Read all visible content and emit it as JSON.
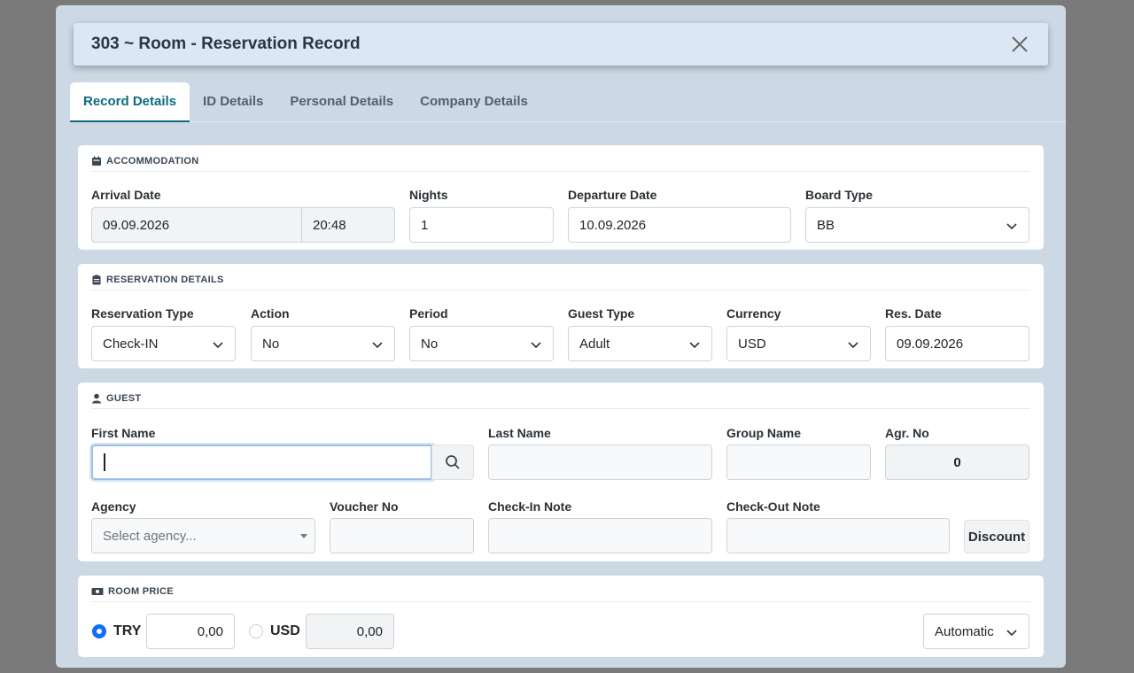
{
  "modal": {
    "title": "303 ~ Room - Reservation Record"
  },
  "tabs": [
    "Record Details",
    "ID Details",
    "Personal Details",
    "Company Details"
  ],
  "accommodation": {
    "title": "ACCOMMODATION",
    "arrival_label": "Arrival Date",
    "arrival_date": "09.09.2026",
    "arrival_time": "20:48",
    "nights_label": "Nights",
    "nights": "1",
    "departure_label": "Departure Date",
    "departure_date": "10.09.2026",
    "board_label": "Board Type",
    "board": "BB"
  },
  "reservation": {
    "title": "RESERVATION DETAILS",
    "type_label": "Reservation Type",
    "type": "Check-IN",
    "action_label": "Action",
    "action": "No",
    "period_label": "Period",
    "period": "No",
    "guest_type_label": "Guest Type",
    "guest_type": "Adult",
    "currency_label": "Currency",
    "currency": "USD",
    "res_date_label": "Res. Date",
    "res_date": "09.09.2026"
  },
  "guest": {
    "title": "GUEST",
    "first_name_label": "First Name",
    "first_name": "",
    "last_name_label": "Last Name",
    "last_name": "",
    "group_label": "Group Name",
    "group": "",
    "agr_label": "Agr. No",
    "agr": "0",
    "agency_label": "Agency",
    "agency_placeholder": "Select agency...",
    "voucher_label": "Voucher No",
    "voucher": "",
    "checkin_note_label": "Check-In Note",
    "checkin_note": "",
    "checkout_note_label": "Check-Out Note",
    "checkout_note": "",
    "discount_label": "Discount"
  },
  "room_price": {
    "title": "ROOM PRICE",
    "try_label": "TRY",
    "try_value": "0,00",
    "try_selected": true,
    "usd_label": "USD",
    "usd_value": "0,00",
    "usd_selected": false,
    "mode": "Automatic"
  },
  "colors": {
    "accent": "#0c6b80",
    "radio": "#0d6efd",
    "modal_bg": "#cdd8e5",
    "header_bg": "#dce7f6"
  }
}
